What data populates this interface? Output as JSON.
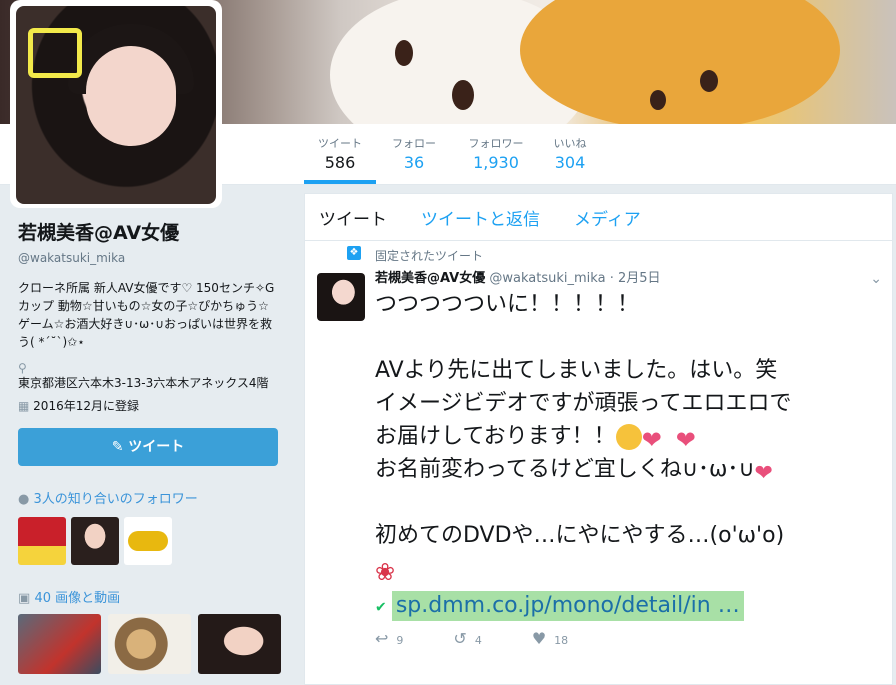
{
  "stats": [
    {
      "label": "ツイート",
      "value": "586"
    },
    {
      "label": "フォロー",
      "value": "36"
    },
    {
      "label": "フォロワー",
      "value": "1,930"
    },
    {
      "label": "いいね",
      "value": "304"
    }
  ],
  "profile": {
    "name": "若槻美香@AV女優",
    "handle": "@wakatsuki_mika",
    "bio": "クローネ所属 新人AV女優です♡ 150センチ✧Gカップ 動物☆甘いもの☆女の子☆ぴかちゅう☆ゲーム☆お酒大好き∪･ω･∪おっぱいは世界を救う( *´˘`)✩⋆",
    "location": "東京都港区六本木3-13-3六本木アネックス4階",
    "joined": "2016年12月に登録",
    "tweet_button": "ツイート",
    "followers_you_know": "3人の知り合いのフォロワー",
    "media_count": "40 画像と動画"
  },
  "tabs": [
    "ツイート",
    "ツイートと返信",
    "メディア"
  ],
  "tweet": {
    "pinned_label": "固定されたツイート",
    "author": "若槻美香@AV女優",
    "handle": "@wakatsuki_mika",
    "date": "2月5日",
    "line1": "つつつつついに！！！！！",
    "line2": "AVより先に出てしまいました。はい。笑",
    "line3": "イメージビデオですが頑張ってエロエロで",
    "line4": "お届けしております！！",
    "line5": "お名前変わってるけど宜しくね∪･ω･∪",
    "line6": "初めてのDVDや…にやにやする…(o'ω'o)",
    "link": "sp.dmm.co.jp/mono/detail/in …",
    "replies": "9",
    "retweets": "4",
    "likes": "18"
  },
  "icons": [
    "location-pin-icon",
    "calendar-icon",
    "person-icon",
    "camera-icon",
    "pin-icon",
    "chevron-down-icon",
    "reply-icon",
    "retweet-icon",
    "heart-icon",
    "check-circle-icon"
  ]
}
